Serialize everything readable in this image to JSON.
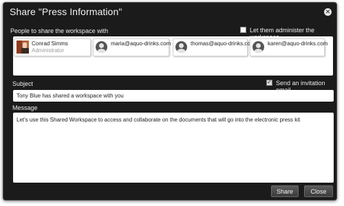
{
  "dialog": {
    "title": "Share \"Press Information\"",
    "close_icon": "close-icon"
  },
  "people": {
    "label": "People to share the workspace with",
    "admin_checkbox_label": "Let them administer the workspace",
    "admin_checked": false,
    "entries": [
      {
        "name": "Conrad Simms",
        "role": "Administrator",
        "avatar": "person-photo"
      },
      {
        "email": "maria@aquo-drinks.com",
        "avatar": "user-icon"
      },
      {
        "email": "thomas@aquo-drinks.com",
        "avatar": "user-icon"
      },
      {
        "email": "karen@aquo-drinks.com",
        "avatar": "user-icon"
      }
    ]
  },
  "subject": {
    "label": "Subject",
    "invite_label": "Send an invitation email",
    "invite_checked": true,
    "value": "Tony Blue has shared a workspace with you"
  },
  "message": {
    "label": "Message",
    "value": "Let's use this Shared Workspace to access and collaborate on  the documents that will go into the electronic press kit"
  },
  "buttons": {
    "share": "Share",
    "close": "Close"
  }
}
